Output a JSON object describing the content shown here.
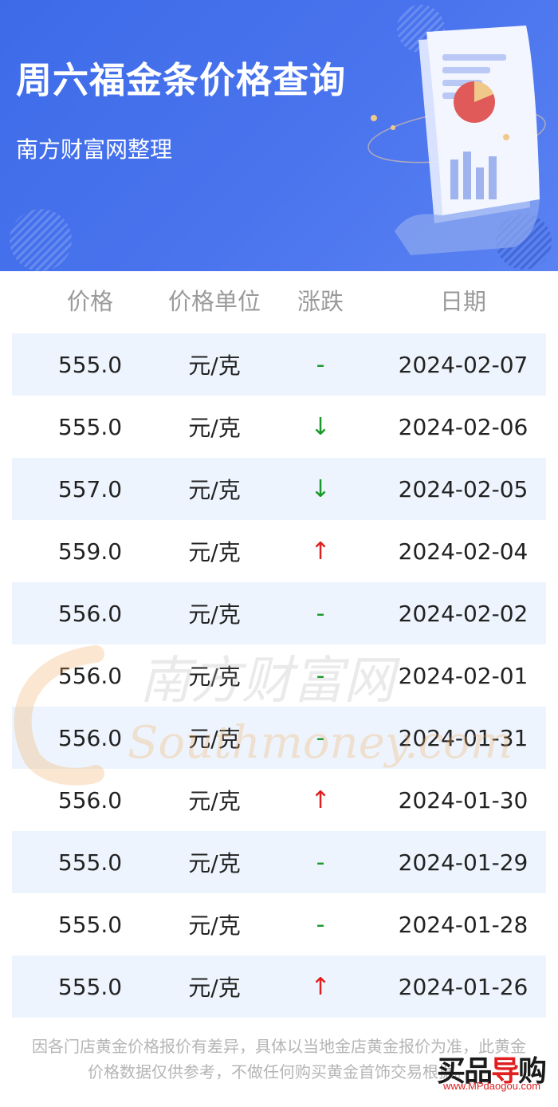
{
  "banner": {
    "title": "周六福金条价格查询",
    "subtitle": "南方财富网整理"
  },
  "table": {
    "headers": [
      "价格",
      "价格单位",
      "涨跌",
      "日期"
    ],
    "rows": [
      {
        "price": "555.0",
        "unit": "元/克",
        "trend": "-",
        "trend_type": "flat",
        "date": "2024-02-07"
      },
      {
        "price": "555.0",
        "unit": "元/克",
        "trend": "↓",
        "trend_type": "down",
        "date": "2024-02-06"
      },
      {
        "price": "557.0",
        "unit": "元/克",
        "trend": "↓",
        "trend_type": "down",
        "date": "2024-02-05"
      },
      {
        "price": "559.0",
        "unit": "元/克",
        "trend": "↑",
        "trend_type": "up",
        "date": "2024-02-04"
      },
      {
        "price": "556.0",
        "unit": "元/克",
        "trend": "-",
        "trend_type": "flat",
        "date": "2024-02-02"
      },
      {
        "price": "556.0",
        "unit": "元/克",
        "trend": "-",
        "trend_type": "flat",
        "date": "2024-02-01"
      },
      {
        "price": "556.0",
        "unit": "元/克",
        "trend": "-",
        "trend_type": "flat",
        "date": "2024-01-31"
      },
      {
        "price": "556.0",
        "unit": "元/克",
        "trend": "↑",
        "trend_type": "up",
        "date": "2024-01-30"
      },
      {
        "price": "555.0",
        "unit": "元/克",
        "trend": "-",
        "trend_type": "flat",
        "date": "2024-01-29"
      },
      {
        "price": "555.0",
        "unit": "元/克",
        "trend": "-",
        "trend_type": "flat",
        "date": "2024-01-28"
      },
      {
        "price": "555.0",
        "unit": "元/克",
        "trend": "↑",
        "trend_type": "up",
        "date": "2024-01-26"
      }
    ]
  },
  "watermark": {
    "cn": "南方财富网",
    "en": "Southmoney.com"
  },
  "footer": {
    "line1": "因各门店黄金价格报价有差异，具体以当地金店黄金报价为准，此黄金",
    "line2": "价格数据仅供参考，不做任何购买黄金首饰交易根据。"
  },
  "logo": {
    "brand_a": "买品",
    "brand_b": "导",
    "brand_c": "购",
    "url": "www.MPdaogou.com"
  },
  "colors": {
    "banner_blue": "#3d6be8",
    "row_stripe": "#eef4fd",
    "up": "#e02020",
    "down": "#1a9a2a"
  }
}
